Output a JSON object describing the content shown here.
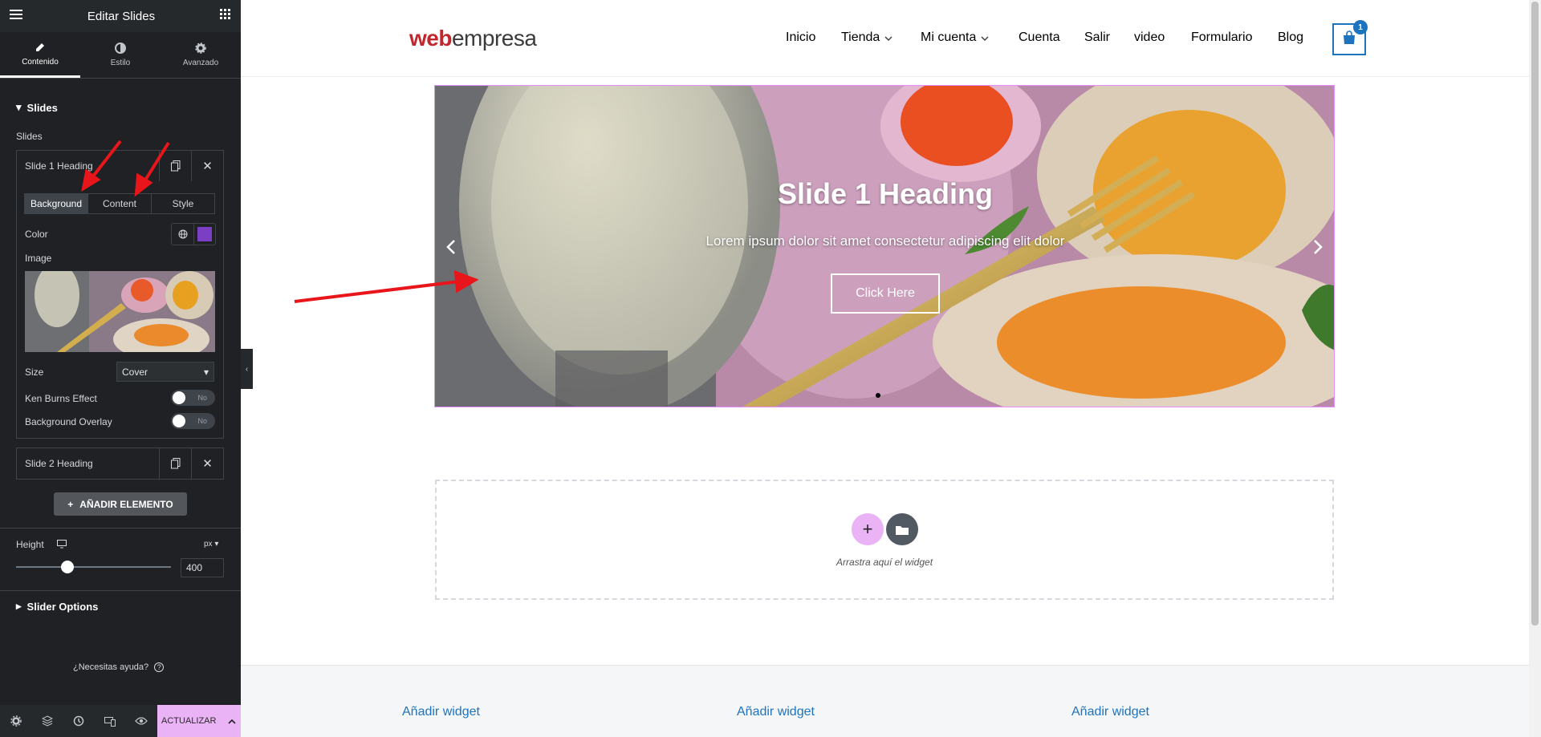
{
  "panel": {
    "title": "Editar Slides",
    "tabs": [
      {
        "label": "Contenido"
      },
      {
        "label": "Estilo"
      },
      {
        "label": "Avanzado"
      }
    ],
    "section_slides": "Slides",
    "slides_label": "Slides",
    "slide1_title": "Slide 1 Heading",
    "subtabs": [
      "Background",
      "Content",
      "Style"
    ],
    "color_label": "Color",
    "color_value": "#7a3fc5",
    "image_label": "Image",
    "size_label": "Size",
    "size_value": "Cover",
    "ken_burns_label": "Ken Burns Effect",
    "ken_burns_value": "No",
    "overlay_label": "Background Overlay",
    "overlay_value": "No",
    "slide2_title": "Slide 2 Heading",
    "add_element": "AÑADIR ELEMENTO",
    "height_label": "Height",
    "height_unit": "px",
    "height_value": "400",
    "height_level": 0.3,
    "slider_options": "Slider Options",
    "help": "¿Necesitas ayuda?",
    "update_button": "ACTUALIZAR"
  },
  "site": {
    "logo_a": "web",
    "logo_b": "empresa",
    "nav": [
      "Inicio",
      "Tienda",
      "Mi cuenta",
      "Cuenta",
      "Salir",
      "video",
      "Formulario",
      "Blog"
    ],
    "cart_count": "1"
  },
  "slide": {
    "heading": "Slide 1 Heading",
    "description": "Lorem ipsum dolor sit amet consectetur adipiscing elit dolor",
    "button": "Click Here"
  },
  "dropzone": {
    "text": "Arrastra aquí el widget"
  },
  "footer": {
    "widgets": [
      "Añadir widget",
      "Añadir widget",
      "Añadir widget"
    ]
  }
}
